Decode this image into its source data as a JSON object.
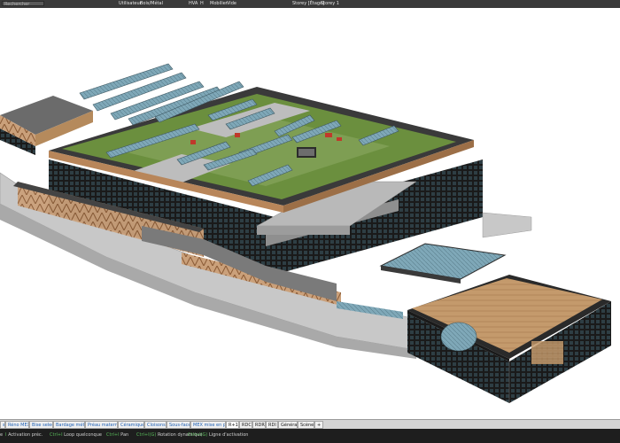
{
  "topbar": {
    "search_placeholder": "Rechercher",
    "user_label": "Utilisateur",
    "user_value": "Bois/Métal",
    "hva_label": "HVA",
    "hva_value": "H",
    "model_label": "Mobilier",
    "model_value": "Vide",
    "storey_label": "Storey [Étage]",
    "storey_value": "Storey 1"
  },
  "tabs": [
    {
      "label": "s",
      "dark": false
    },
    {
      "label": "Réno MEX",
      "dark": false
    },
    {
      "label": "Bise select",
      "dark": false
    },
    {
      "label": "Bardage métal",
      "dark": false
    },
    {
      "label": "Préau maternelle",
      "dark": false
    },
    {
      "label": "Céramique",
      "dark": false
    },
    {
      "label": "Cloisons",
      "dark": false
    },
    {
      "label": "Sous-face",
      "dark": false
    },
    {
      "label": "MEX mise en plan",
      "dark": false
    },
    {
      "label": "R+1",
      "dark": true,
      "active": true
    },
    {
      "label": "RDC",
      "dark": true
    },
    {
      "label": "RDR",
      "dark": true
    },
    {
      "label": "RDI",
      "dark": true
    },
    {
      "label": "Général",
      "dark": true
    },
    {
      "label": "Scène",
      "dark": true
    },
    {
      "label": "+",
      "dark": true
    }
  ],
  "status": {
    "items": [
      {
        "key": "",
        "label": "e"
      },
      {
        "key": "I",
        "label": "Activation préc."
      },
      {
        "key": "Ctrl+I",
        "label": "Loop quelconque"
      },
      {
        "key": "Ctrl+I",
        "label": "Pan"
      },
      {
        "key": "Ctrl+I(G)",
        "label": "Rotation dynamique"
      },
      {
        "key": "Ctrl+I(G)",
        "label": "Ligne d'activation"
      }
    ]
  },
  "colors": {
    "roof_green": "#6b8f3e",
    "facade_dark": "#151515",
    "timber": "#b9865a",
    "glass": "#7fa8b8",
    "concrete": "#b8b8b8"
  }
}
